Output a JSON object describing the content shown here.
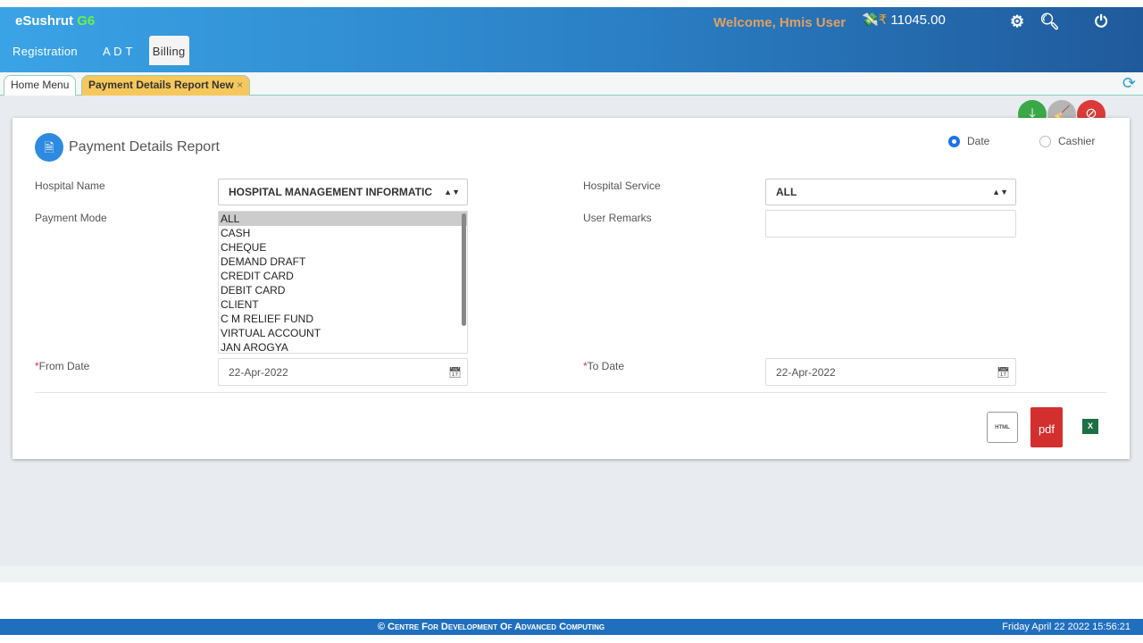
{
  "header": {
    "brand": "eSushrut",
    "brand_suffix": "G6",
    "menu": [
      "Registration",
      "A D T",
      "Billing"
    ],
    "active_menu": "Billing",
    "welcome": "Welcome, Hmis User",
    "currency": "₹",
    "balance": "11045.00"
  },
  "tabs": [
    {
      "label": "Home Menu"
    },
    {
      "label": "Payment Details Report New",
      "close": "×"
    }
  ],
  "form": {
    "title": "Payment Details Report",
    "radios": [
      {
        "label": "Date",
        "checked": true
      },
      {
        "label": "Cashier",
        "checked": false
      }
    ],
    "hospital_name_label": "Hospital Name",
    "hospital_name_value": "HOSPITAL MANAGEMENT INFORMATIC",
    "hospital_service_label": "Hospital Service",
    "hospital_service_value": "ALL",
    "payment_mode_label": "Payment Mode",
    "payment_modes": [
      "ALL",
      "CASH",
      "CHEQUE",
      "DEMAND DRAFT",
      "CREDIT CARD",
      "DEBIT CARD",
      "CLIENT",
      "C M RELIEF FUND",
      "VIRTUAL ACCOUNT",
      "JAN AROGYA"
    ],
    "selected_mode": "ALL",
    "user_remarks_label": "User Remarks",
    "user_remarks_value": "",
    "from_date_label": "From Date",
    "from_date": "22-Apr-2022",
    "to_date_label": "To Date",
    "to_date": "22-Apr-2022",
    "required_mark": "*",
    "pdf_label": "pdf",
    "html_label": "HTML"
  },
  "colors": {
    "save": "#3aa846",
    "clear": "#b5b5b5",
    "cancel": "#d93a3a",
    "pdf": "#d32f2f",
    "excel": "#1d7044"
  },
  "footer": {
    "copyright": "© Centre For Development Of Advanced Computing",
    "datetime": "Friday April 22 2022 15:56:21"
  }
}
